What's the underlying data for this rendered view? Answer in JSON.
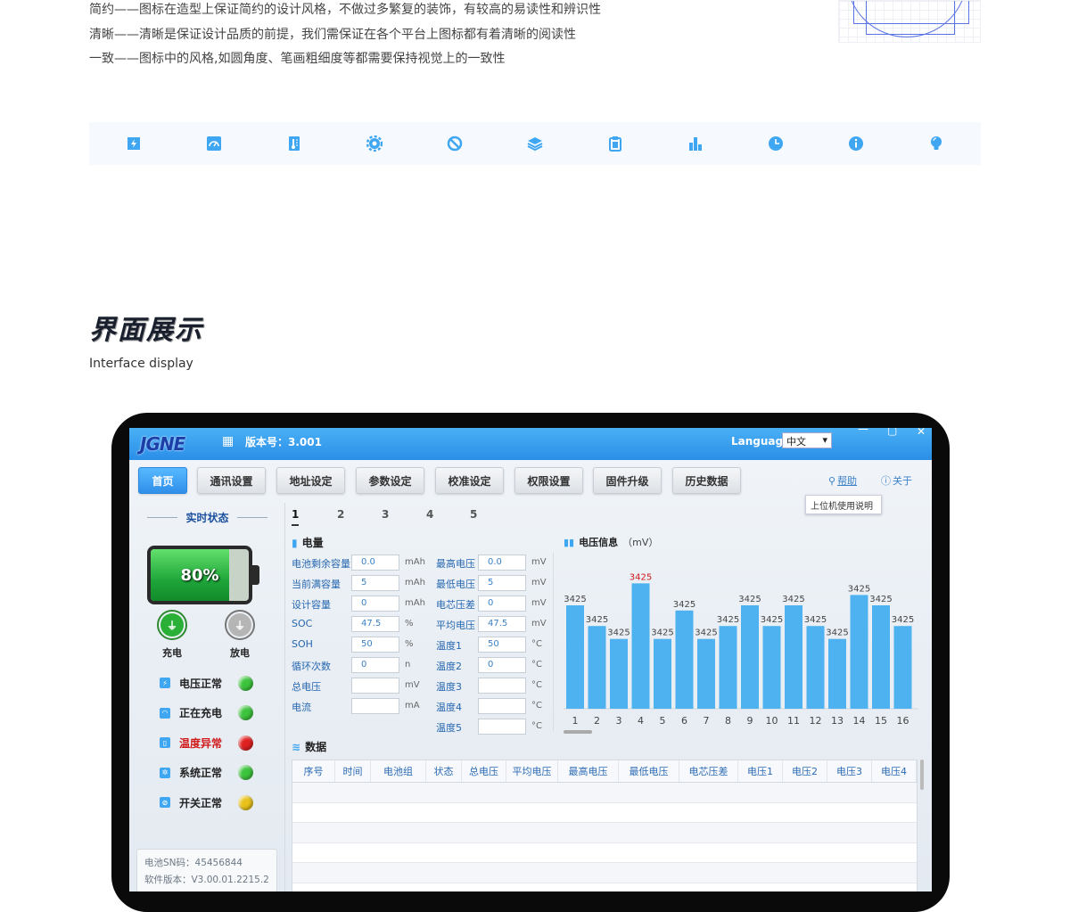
{
  "intro": {
    "lines": [
      "简约——图标在造型上保证简约的设计风格，不做过多繁复的装饰，有较高的易读性和辨识性",
      "清晰——清晰是保证设计品质的前提，我们需保证在各个平台上图标都有着清晰的阅读性",
      "一致——图标中的风格,如圆角度、笔画粗细度等都需要保持视觉上的一致性"
    ]
  },
  "iconbar": [
    "battery-bolt-icon",
    "voltmeter-icon",
    "thermometer-icon",
    "gear-icon",
    "ban-icon",
    "layers-icon",
    "clipboard-icon",
    "bar-chart-icon",
    "clock-icon",
    "info-icon",
    "bulb-icon"
  ],
  "section": {
    "title": "界面展示",
    "subtitle": "Interface display"
  },
  "app": {
    "logo": "JGNE",
    "version_label": "版本号：3.001",
    "language_label": "Language",
    "language_value": "中文",
    "nav": [
      "首页",
      "通讯设置",
      "地址设定",
      "参数设定",
      "校准设定",
      "权限设置",
      "固件升级",
      "历史数据"
    ],
    "help": "帮助",
    "about": "关于",
    "tooltip": "上位机使用说明",
    "left": {
      "title": "实时状态",
      "battery_pct": "80%",
      "battery_level": 0.8,
      "charge_label": "充电",
      "discharge_label": "放电",
      "statuses": [
        {
          "label": "电压正常",
          "color": "#3cc43c",
          "icon": "battery-bolt-icon",
          "alert": false
        },
        {
          "label": "正在充电",
          "color": "#3cc43c",
          "icon": "voltmeter-icon",
          "alert": false
        },
        {
          "label": "温度异常",
          "color": "#e02020",
          "icon": "thermometer-icon",
          "alert": true
        },
        {
          "label": "系统正常",
          "color": "#3cc43c",
          "icon": "gear-icon",
          "alert": false
        },
        {
          "label": "开关正常",
          "color": "#e8c21a",
          "icon": "ban-icon",
          "alert": false
        }
      ],
      "info": [
        "电池SN码：45456844",
        "软件版本：V3.00.01.2215.2"
      ]
    },
    "tabs": [
      "1",
      "2",
      "3",
      "4",
      "5"
    ],
    "power": {
      "title": "电量",
      "left_fields": [
        {
          "label": "电池剩余容量",
          "value": "0.0",
          "unit": "mAh"
        },
        {
          "label": "当前满容量",
          "value": "5",
          "unit": "mAh"
        },
        {
          "label": "设计容量",
          "value": "0",
          "unit": "mAh"
        },
        {
          "label": "SOC",
          "value": "47.5",
          "unit": "%"
        },
        {
          "label": "SOH",
          "value": "50",
          "unit": "%"
        },
        {
          "label": "循环次数",
          "value": "0",
          "unit": "n"
        },
        {
          "label": "总电压",
          "value": "",
          "unit": "mV"
        },
        {
          "label": "电流",
          "value": "",
          "unit": "mA"
        }
      ],
      "right_fields": [
        {
          "label": "最高电压",
          "value": "0.0",
          "unit": "mV"
        },
        {
          "label": "最低电压",
          "value": "5",
          "unit": "mV"
        },
        {
          "label": "电芯压差",
          "value": "0",
          "unit": "mV"
        },
        {
          "label": "平均电压",
          "value": "47.5",
          "unit": "mV"
        },
        {
          "label": "温度1",
          "value": "50",
          "unit": "°C"
        },
        {
          "label": "温度2",
          "value": "0",
          "unit": "°C"
        },
        {
          "label": "温度3",
          "value": "",
          "unit": "°C"
        },
        {
          "label": "温度4",
          "value": "",
          "unit": "°C"
        },
        {
          "label": "温度5",
          "value": "",
          "unit": "°C"
        }
      ]
    },
    "voltage_title": "电压信息",
    "voltage_unit": "（mV）",
    "data_title": "数据",
    "table_headers": [
      "序号",
      "时间",
      "电池组",
      "状态",
      "总电压",
      "平均电压",
      "最高电压",
      "最低电压",
      "电芯压差",
      "电压1",
      "电压2",
      "电压3",
      "电压4"
    ]
  },
  "chart_data": {
    "type": "bar",
    "categories": [
      "1",
      "2",
      "3",
      "4",
      "5",
      "6",
      "7",
      "8",
      "9",
      "10",
      "11",
      "12",
      "13",
      "14",
      "15",
      "16"
    ],
    "values": [
      3425,
      3425,
      3425,
      3425,
      3425,
      3425,
      3425,
      3425,
      3425,
      3425,
      3425,
      3425,
      3425,
      3425,
      3425,
      3425
    ],
    "relative_heights": [
      0.8,
      0.64,
      0.54,
      0.97,
      0.54,
      0.76,
      0.54,
      0.64,
      0.8,
      0.64,
      0.8,
      0.64,
      0.54,
      0.88,
      0.8,
      0.64
    ],
    "highlight_index": 3,
    "bar_color": "#4fb2f0",
    "highlight_label_color": "#d01818"
  }
}
